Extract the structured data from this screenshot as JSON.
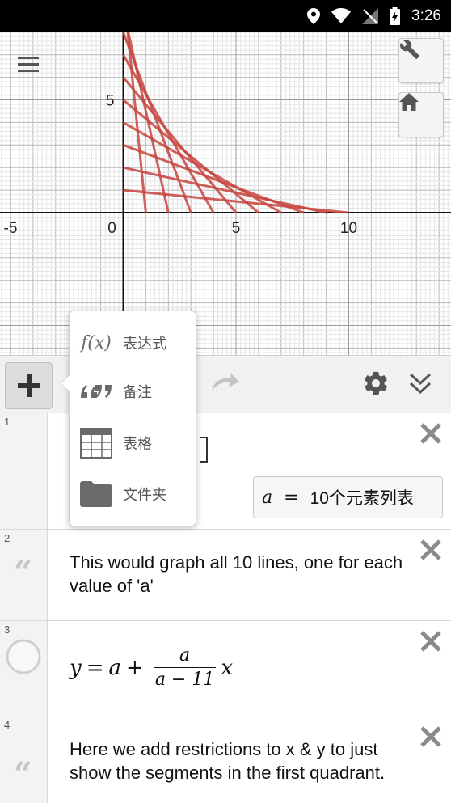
{
  "status_bar": {
    "time": "3:26"
  },
  "graph": {
    "x_ticks": [
      "-5",
      "0",
      "5",
      "10"
    ],
    "y_ticks": [
      "5"
    ],
    "line_color": "#c74440",
    "a_values": [
      1,
      2,
      3,
      4,
      5,
      6,
      7,
      8,
      9,
      10
    ]
  },
  "toolbar": {},
  "add_menu": {
    "items": [
      {
        "label": "表达式",
        "icon": "fx-icon"
      },
      {
        "label": "备注",
        "icon": "quote-icon"
      },
      {
        "label": "表格",
        "icon": "table-icon"
      },
      {
        "label": "文件夹",
        "icon": "folder-icon"
      }
    ],
    "fx_text": "f(x)"
  },
  "expressions": [
    {
      "num": "1",
      "list_var": "a",
      "list_eq": "=",
      "list_value": "10个元素列表"
    },
    {
      "num": "2",
      "text": "This would graph all 10 lines, one for each value of 'a'"
    },
    {
      "num": "3",
      "latex_y": "y",
      "latex_eq": "=",
      "latex_a": "a",
      "latex_plus": "+",
      "frac_num": "a",
      "frac_den": "a − 11",
      "latex_x": "x"
    },
    {
      "num": "4",
      "text": "Here we add restrictions to x & y to just show the segments in the first quadrant."
    }
  ],
  "quote_glyph": "“"
}
